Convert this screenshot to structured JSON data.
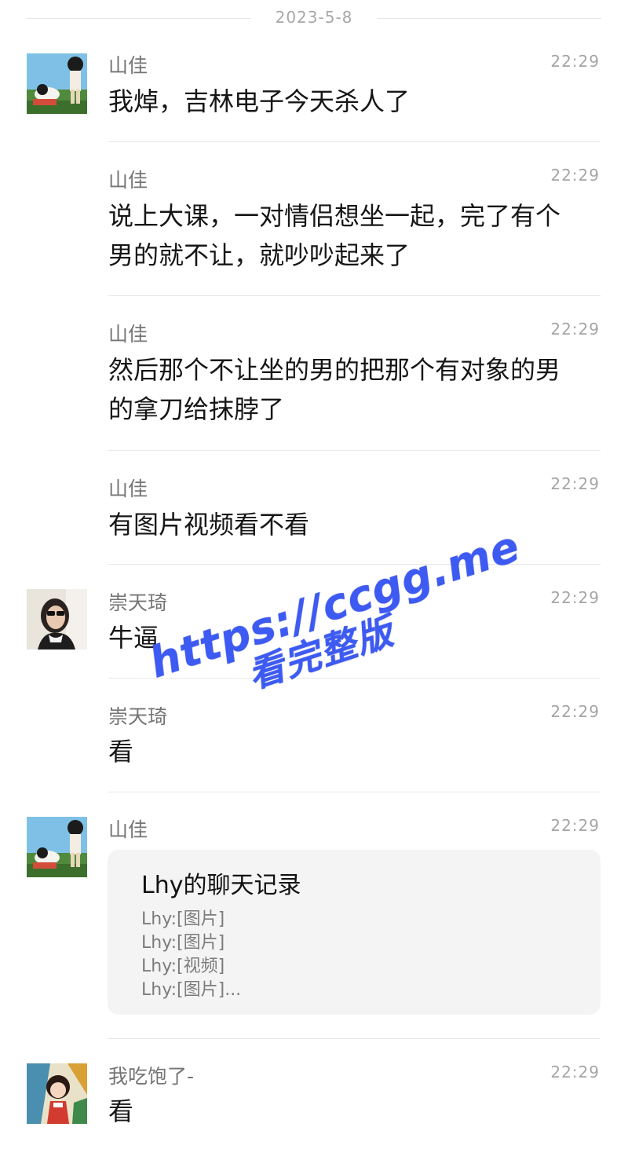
{
  "date": "2023-5-8",
  "messages": [
    {
      "sender": "山佳",
      "time": "22:29",
      "text": [
        "我焯，吉林电子今天杀人了"
      ],
      "avatar": "anime-avatar"
    },
    {
      "sender": "山佳",
      "time": "22:29",
      "text": [
        "说上大课，一对情侣想坐一起，完了有个",
        "男的就不让，就吵吵起来了"
      ]
    },
    {
      "sender": "山佳",
      "time": "22:29",
      "text": [
        "然后那个不让坐的男的把那个有对象的男",
        "的拿刀给抹脖了"
      ]
    },
    {
      "sender": "山佳",
      "time": "22:29",
      "text": [
        "有图片视频看不看"
      ]
    },
    {
      "sender": "崇天琦",
      "time": "22:29",
      "text": [
        "牛逼"
      ],
      "avatar": "photo-avatar"
    },
    {
      "sender": "崇天琦",
      "time": "22:29",
      "text": [
        "看"
      ]
    },
    {
      "sender": "山佳",
      "time": "22:29",
      "avatar": "anime-avatar",
      "card": {
        "title": "Lhy的聊天记录",
        "lines": [
          "Lhy:[图片]",
          "Lhy:[图片]",
          "Lhy:[视频]",
          "Lhy:[图片]..."
        ]
      }
    },
    {
      "sender": "我吃饱了-",
      "time": "22:29",
      "text": [
        "看"
      ],
      "avatar": "cartoon-girl-avatar"
    }
  ],
  "watermark": {
    "url": "https://ccgg.me",
    "subtitle": "看完整版"
  },
  "colors": {
    "sender": "#757575",
    "time": "#a5a5a5",
    "watermark": "#3d5bf2",
    "card_bg": "#f4f4f4"
  }
}
